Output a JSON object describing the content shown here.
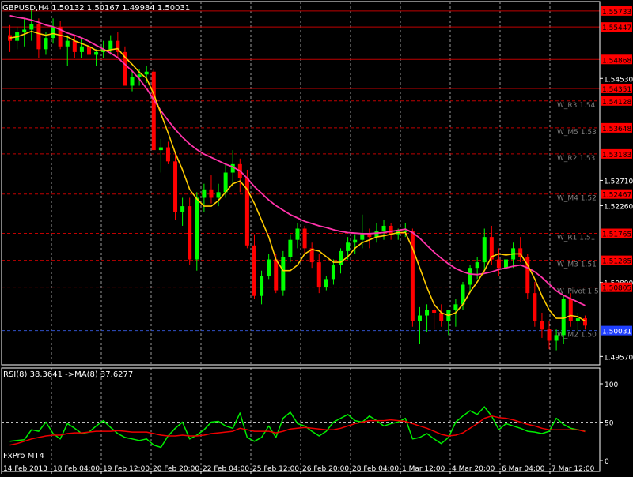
{
  "header": {
    "symbol_line": "GBPUSD,H4  1.50132  1.50167  1.49984  1.50031"
  },
  "footer": {
    "broker": "FxPro MT4"
  },
  "colors": {
    "background": "#000000",
    "bull": "#00ff00",
    "bear": "#ff0000",
    "sma_fast": "#ffcc00",
    "sma_slow": "#ff33aa",
    "level_line": "#c00000",
    "grid": "#c0c0c0",
    "rsi_line": "#00ee00",
    "rsi_ma": "#ee0000",
    "price_text": "#ffffff",
    "label_text": "#7f7f7f"
  },
  "chart_data": [
    {
      "type": "candlestick",
      "title": "GBPUSD,H4",
      "ylim": [
        1.4942,
        1.559
      ],
      "y_ticks": [
        "1.54530",
        "1.52710",
        "1.52260",
        "1.50890",
        "1.49570"
      ],
      "x_ticks": [
        "14 Feb 2013",
        "18 Feb 04:00",
        "19 Feb 12:00",
        "20 Feb 20:00",
        "22 Feb 04:00",
        "25 Feb 12:00",
        "26 Feb 20:00",
        "28 Feb 04:00",
        "1 Mar 12:00",
        "4 Mar 20:00",
        "6 Mar 04:00",
        "7 Mar 12:00"
      ],
      "grid": true,
      "candles": [
        [
          1.553,
          1.5548,
          1.55,
          1.552
        ],
        [
          1.552,
          1.5545,
          1.5505,
          1.5535
        ],
        [
          1.5535,
          1.556,
          1.551,
          1.554
        ],
        [
          1.554,
          1.5575,
          1.552,
          1.555
        ],
        [
          1.555,
          1.556,
          1.549,
          1.5505
        ],
        [
          1.5505,
          1.5535,
          1.5495,
          1.5525
        ],
        [
          1.5525,
          1.556,
          1.5515,
          1.5545
        ],
        [
          1.5545,
          1.5555,
          1.5505,
          1.551
        ],
        [
          1.551,
          1.553,
          1.5475,
          1.552
        ],
        [
          1.552,
          1.553,
          1.549,
          1.55
        ],
        [
          1.55,
          1.5525,
          1.549,
          1.551
        ],
        [
          1.551,
          1.552,
          1.548,
          1.5495
        ],
        [
          1.5495,
          1.5505,
          1.5475,
          1.55
        ],
        [
          1.55,
          1.552,
          1.549,
          1.5505
        ],
        [
          1.5505,
          1.553,
          1.5495,
          1.552
        ],
        [
          1.552,
          1.5535,
          1.549,
          1.55
        ],
        [
          1.55,
          1.551,
          1.545,
          1.544
        ],
        [
          1.544,
          1.5465,
          1.543,
          1.5455
        ],
        [
          1.5455,
          1.547,
          1.544,
          1.546
        ],
        [
          1.546,
          1.5475,
          1.5445,
          1.5465
        ],
        [
          1.5465,
          1.547,
          1.533,
          1.5325
        ],
        [
          1.5325,
          1.5345,
          1.5285,
          1.533
        ],
        [
          1.533,
          1.534,
          1.53,
          1.5305
        ],
        [
          1.5305,
          1.532,
          1.52,
          1.5215
        ],
        [
          1.5215,
          1.524,
          1.519,
          1.5225
        ],
        [
          1.5225,
          1.524,
          1.512,
          1.513
        ],
        [
          1.513,
          1.525,
          1.511,
          1.524
        ],
        [
          1.524,
          1.5265,
          1.5215,
          1.5255
        ],
        [
          1.5255,
          1.528,
          1.523,
          1.524
        ],
        [
          1.524,
          1.5265,
          1.5225,
          1.525
        ],
        [
          1.525,
          1.53,
          1.524,
          1.5285
        ],
        [
          1.5285,
          1.5325,
          1.526,
          1.53
        ],
        [
          1.53,
          1.531,
          1.525,
          1.5275
        ],
        [
          1.5275,
          1.529,
          1.515,
          1.5155
        ],
        [
          1.5155,
          1.5175,
          1.506,
          1.5065
        ],
        [
          1.5065,
          1.511,
          1.505,
          1.51
        ],
        [
          1.51,
          1.514,
          1.5095,
          1.513
        ],
        [
          1.513,
          1.514,
          1.507,
          1.5075
        ],
        [
          1.5075,
          1.5145,
          1.5065,
          1.5135
        ],
        [
          1.5135,
          1.5175,
          1.5125,
          1.5165
        ],
        [
          1.5165,
          1.5195,
          1.515,
          1.5185
        ],
        [
          1.5185,
          1.519,
          1.514,
          1.515
        ],
        [
          1.515,
          1.516,
          1.5115,
          1.5125
        ],
        [
          1.5125,
          1.514,
          1.507,
          1.508
        ],
        [
          1.508,
          1.51,
          1.5075,
          1.5095
        ],
        [
          1.5095,
          1.513,
          1.5085,
          1.512
        ],
        [
          1.512,
          1.515,
          1.5105,
          1.5145
        ],
        [
          1.5145,
          1.517,
          1.513,
          1.516
        ],
        [
          1.516,
          1.5175,
          1.514,
          1.5165
        ],
        [
          1.5165,
          1.521,
          1.515,
          1.5175
        ],
        [
          1.5175,
          1.5185,
          1.515,
          1.517
        ],
        [
          1.517,
          1.5195,
          1.516,
          1.518
        ],
        [
          1.518,
          1.52,
          1.5165,
          1.519
        ],
        [
          1.519,
          1.5195,
          1.5165,
          1.5175
        ],
        [
          1.5175,
          1.5185,
          1.5165,
          1.518
        ],
        [
          1.518,
          1.5195,
          1.517,
          1.518
        ],
        [
          1.518,
          1.5185,
          1.501,
          1.502
        ],
        [
          1.502,
          1.5045,
          1.498,
          1.503
        ],
        [
          1.503,
          1.505,
          1.5,
          1.504
        ],
        [
          1.504,
          1.5055,
          1.5005,
          1.5035
        ],
        [
          1.5035,
          1.505,
          1.501,
          1.502
        ],
        [
          1.502,
          1.504,
          1.4995,
          1.504
        ],
        [
          1.504,
          1.506,
          1.501,
          1.505
        ],
        [
          1.505,
          1.509,
          1.504,
          1.5085
        ],
        [
          1.5085,
          1.512,
          1.507,
          1.5115
        ],
        [
          1.5115,
          1.5135,
          1.5095,
          1.5125
        ],
        [
          1.5125,
          1.5185,
          1.511,
          1.517
        ],
        [
          1.517,
          1.519,
          1.512,
          1.513
        ],
        [
          1.513,
          1.515,
          1.51,
          1.5115
        ],
        [
          1.5115,
          1.5145,
          1.5095,
          1.513
        ],
        [
          1.513,
          1.516,
          1.5115,
          1.515
        ],
        [
          1.515,
          1.517,
          1.5125,
          1.5135
        ],
        [
          1.5135,
          1.514,
          1.506,
          1.507
        ],
        [
          1.507,
          1.509,
          1.501,
          1.502
        ],
        [
          1.502,
          1.5035,
          1.499,
          1.5005
        ],
        [
          1.5005,
          1.502,
          1.497,
          1.4985
        ],
        [
          1.4985,
          1.5005,
          1.4968,
          1.4995
        ],
        [
          1.4995,
          1.5065,
          1.498,
          1.506
        ],
        [
          1.506,
          1.507,
          1.501,
          1.502
        ],
        [
          1.502,
          1.5035,
          1.5,
          1.5025
        ],
        [
          1.5025,
          1.503,
          1.5005,
          1.5012
        ]
      ],
      "sma_fast_name": "",
      "sma_fast": [
        1.5525,
        1.5527,
        1.5532,
        1.5537,
        1.5533,
        1.553,
        1.5533,
        1.553,
        1.5527,
        1.552,
        1.5515,
        1.551,
        1.5503,
        1.5502,
        1.5504,
        1.5506,
        1.5491,
        1.5478,
        1.5464,
        1.5453,
        1.5425,
        1.539,
        1.5356,
        1.532,
        1.529,
        1.5255,
        1.5238,
        1.5225,
        1.5225,
        1.5235,
        1.525,
        1.5265,
        1.527,
        1.5255,
        1.523,
        1.52,
        1.517,
        1.513,
        1.511,
        1.511,
        1.512,
        1.514,
        1.5148,
        1.5145,
        1.5135,
        1.5125,
        1.5125,
        1.5135,
        1.515,
        1.516,
        1.5165,
        1.517,
        1.5172,
        1.5175,
        1.5178,
        1.5178,
        1.515,
        1.5115,
        1.508,
        1.505,
        1.5035,
        1.503,
        1.5035,
        1.505,
        1.5072,
        1.509,
        1.511,
        1.5135,
        1.514,
        1.5138,
        1.514,
        1.514,
        1.512,
        1.5095,
        1.5065,
        1.504,
        1.5025,
        1.5025,
        1.503,
        1.5028,
        1.502
      ],
      "sma_slow_name": "",
      "sma_slow": [
        1.5565,
        1.5562,
        1.556,
        1.5557,
        1.5553,
        1.5548,
        1.5545,
        1.554,
        1.5534,
        1.553,
        1.5525,
        1.5519,
        1.5512,
        1.5505,
        1.5498,
        1.549,
        1.5478,
        1.5466,
        1.5452,
        1.5435,
        1.5415,
        1.5395,
        1.5378,
        1.5362,
        1.5348,
        1.5336,
        1.5326,
        1.5318,
        1.5312,
        1.5306,
        1.53,
        1.5295,
        1.5288,
        1.5275,
        1.526,
        1.5248,
        1.5236,
        1.5226,
        1.5218,
        1.521,
        1.5204,
        1.5198,
        1.5194,
        1.519,
        1.5187,
        1.5183,
        1.518,
        1.5178,
        1.5177,
        1.5176,
        1.5176,
        1.5177,
        1.5178,
        1.518,
        1.5182,
        1.5184,
        1.5178,
        1.5168,
        1.5155,
        1.5143,
        1.5132,
        1.5122,
        1.5114,
        1.5108,
        1.5104,
        1.5103,
        1.5105,
        1.5108,
        1.5112,
        1.5115,
        1.5118,
        1.512,
        1.5115,
        1.5108,
        1.5098,
        1.5086,
        1.5074,
        1.5066,
        1.506,
        1.5054,
        1.5048
      ],
      "levels": [
        {
          "name": "",
          "value": 1.55733,
          "tag": "1.55733"
        },
        {
          "name": "",
          "value": 1.55447,
          "tag": "1.55447"
        },
        {
          "name": "",
          "value": 1.54868,
          "tag": "1.54868"
        },
        {
          "name": "",
          "value": 1.54351,
          "tag": "1.54351"
        },
        {
          "name": "W_R3 1.54",
          "value": 1.54128,
          "tag": "1.54128"
        },
        {
          "name": "W_M5 1.53",
          "value": 1.53648,
          "tag": "1.53648"
        },
        {
          "name": "W_R2 1.53",
          "value": 1.53183,
          "tag": "1.53183"
        },
        {
          "name": "W_M4 1.52",
          "value": 1.52467,
          "tag": "1.52467"
        },
        {
          "name": "W_R1 1.51",
          "value": 1.51765,
          "tag": "1.51765"
        },
        {
          "name": "W_M3 1.51",
          "value": 1.51285,
          "tag": "1.51285"
        },
        {
          "name": "W_Pivot 1.5",
          "value": 1.50805,
          "tag": "1.50805"
        },
        {
          "name": "W_M2 1.50",
          "value": 1.50031,
          "tag": "1.50031"
        }
      ]
    },
    {
      "type": "line",
      "title": "RSI(8) 38.3641  ->MA(8) 37.6277",
      "ylim": [
        0,
        100
      ],
      "y_ticks": [
        100,
        50,
        0
      ],
      "series": [
        {
          "name": "RSI(8)",
          "values": [
            25,
            26,
            27,
            40,
            38,
            50,
            35,
            28,
            48,
            42,
            35,
            37,
            45,
            52,
            43,
            35,
            30,
            28,
            26,
            28,
            20,
            17,
            32,
            42,
            50,
            28,
            33,
            40,
            50,
            51,
            45,
            42,
            62,
            30,
            25,
            30,
            45,
            30,
            55,
            63,
            48,
            45,
            38,
            32,
            38,
            50,
            55,
            60,
            52,
            50,
            58,
            52,
            45,
            48,
            50,
            55,
            28,
            30,
            35,
            28,
            22,
            30,
            50,
            58,
            65,
            60,
            70,
            58,
            40,
            48,
            45,
            42,
            38,
            37,
            35,
            38,
            55,
            47,
            42,
            40,
            38
          ]
        },
        {
          "name": "MA(8)",
          "values": [
            20,
            22,
            25,
            28,
            30,
            32,
            33,
            33,
            35,
            36,
            36,
            37,
            38,
            38,
            38,
            39,
            38,
            37,
            37,
            37,
            35,
            33,
            32,
            32,
            33,
            32,
            32,
            33,
            35,
            36,
            37,
            38,
            42,
            40,
            38,
            38,
            38,
            36,
            38,
            41,
            42,
            43,
            42,
            41,
            40,
            40,
            42,
            45,
            48,
            50,
            52,
            52,
            52,
            53,
            52,
            51,
            48,
            45,
            42,
            38,
            34,
            32,
            33,
            36,
            42,
            48,
            55,
            58,
            56,
            55,
            53,
            50,
            47,
            45,
            42,
            40,
            40,
            40,
            40,
            40,
            37.6
          ]
        }
      ]
    }
  ]
}
